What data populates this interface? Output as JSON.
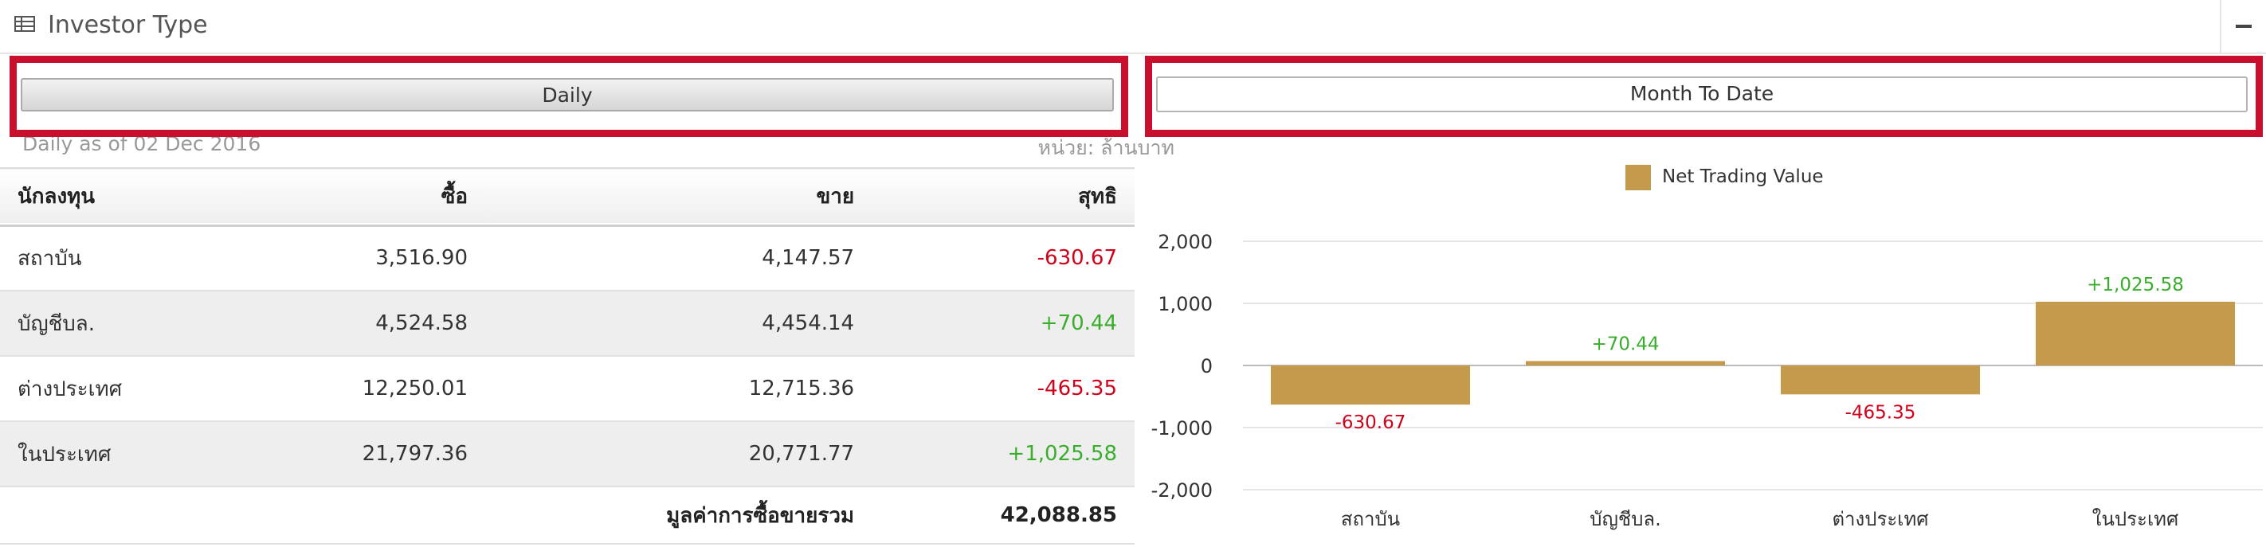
{
  "panel": {
    "title": "Investor Type",
    "icon": "table-icon"
  },
  "tabs": {
    "daily": "Daily",
    "month_to_date": "Month To Date"
  },
  "subheader": {
    "as_of": "Daily as of 02 Dec 2016",
    "unit": "หน่วย: ล้านบาท"
  },
  "table": {
    "headers": [
      "นักลงทุน",
      "ซื้อ",
      "ขาย",
      "สุทธิ"
    ],
    "rows": [
      {
        "investor": "สถาบัน",
        "buy": "3,516.90",
        "sell": "4,147.57",
        "net": "-630.67"
      },
      {
        "investor": "บัญชีบล.",
        "buy": "4,524.58",
        "sell": "4,454.14",
        "net": "+70.44"
      },
      {
        "investor": "ต่างประเทศ",
        "buy": "12,250.01",
        "sell": "12,715.36",
        "net": "-465.35"
      },
      {
        "investor": "ในประเทศ",
        "buy": "21,797.36",
        "sell": "20,771.77",
        "net": "+1,025.58"
      }
    ],
    "total_label": "มูลค่าการซื้อขายรวม",
    "total_value": "42,088.85"
  },
  "colors": {
    "bar": "#c49a4c",
    "negative": "#d0021b",
    "positive": "#3aad2c",
    "highlight": "#c8102e"
  },
  "chart_data": {
    "type": "bar",
    "categories": [
      "สถาบัน",
      "บัญชีบล.",
      "ต่างประเทศ",
      "ในประเทศ"
    ],
    "series": [
      {
        "name": "Net Trading Value",
        "values": [
          -630.67,
          70.44,
          -465.35,
          1025.58
        ]
      }
    ],
    "data_labels": [
      "-630.67",
      "+70.44",
      "-465.35",
      "+1,025.58"
    ],
    "ylim": [
      -2000,
      2000
    ],
    "yticks": [
      2000,
      1000,
      0,
      -1000,
      -2000
    ],
    "ytick_labels": [
      "2,000",
      "1,000",
      "0",
      "-1,000",
      "-2,000"
    ],
    "grid": true,
    "legend": "top-center"
  }
}
